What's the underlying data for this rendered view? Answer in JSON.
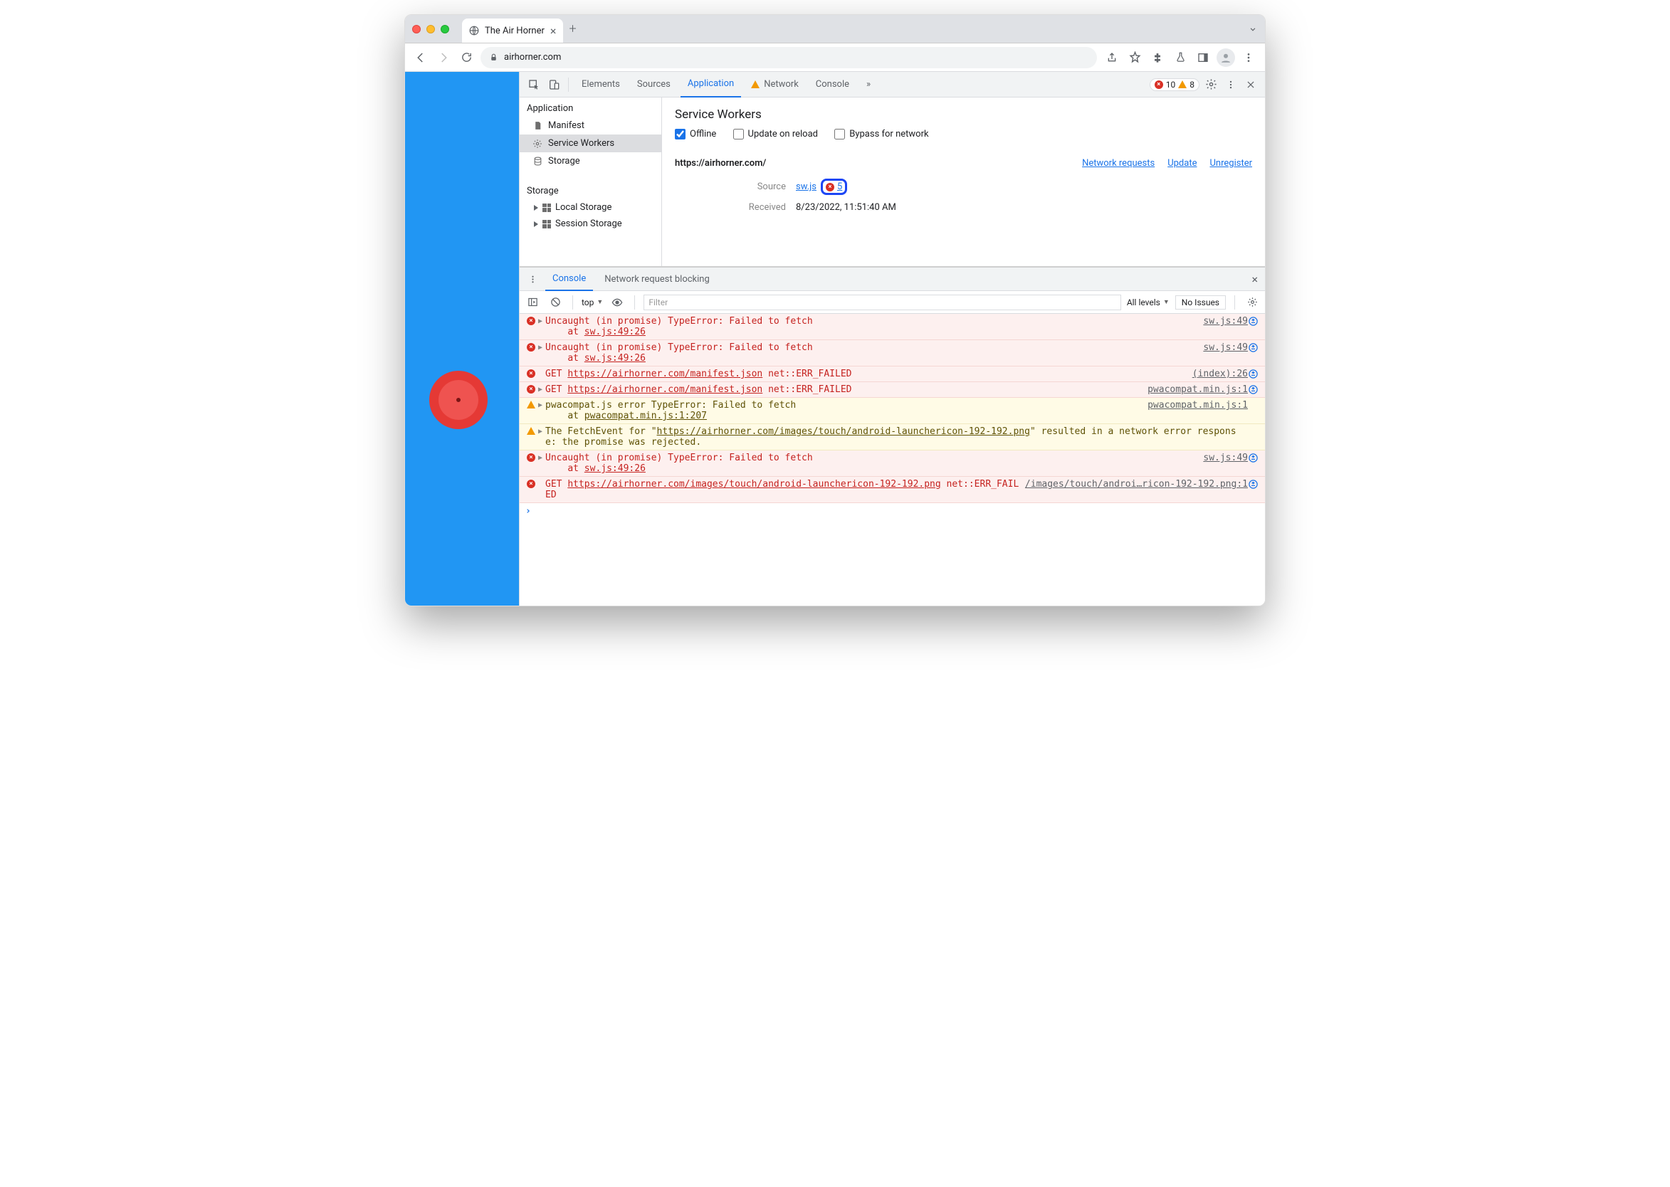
{
  "window": {
    "tab_title": "The Air Horner",
    "url_display": "airhorner.com"
  },
  "devtools": {
    "tabs": [
      "Elements",
      "Sources",
      "Application",
      "Network",
      "Console"
    ],
    "active_tab": "Application",
    "error_count": "10",
    "warn_count": "8"
  },
  "app_panel": {
    "section1_title": "Application",
    "items1": [
      "Manifest",
      "Service Workers",
      "Storage"
    ],
    "section2_title": "Storage",
    "items2": [
      "Local Storage",
      "Session Storage"
    ],
    "main_title": "Service Workers",
    "chk_offline": "Offline",
    "chk_update": "Update on reload",
    "chk_bypass": "Bypass for network",
    "origin": "https://airhorner.com/",
    "link_network": "Network requests",
    "link_update": "Update",
    "link_unregister": "Unregister",
    "label_source": "Source",
    "source_file": "sw.js",
    "source_err_count": "5",
    "label_received": "Received",
    "received_value": "8/23/2022, 11:51:40 AM"
  },
  "drawer": {
    "tabs": [
      "Console",
      "Network request blocking"
    ],
    "active": "Console",
    "context": "top",
    "filter_placeholder": "Filter",
    "levels": "All levels",
    "issues": "No Issues"
  },
  "console": [
    {
      "type": "err",
      "caret": true,
      "msg": "Uncaught (in promise) TypeError: Failed to fetch\n    at ",
      "msg_link": "sw.js:49:26",
      "src": "sw.js:49",
      "reload": true
    },
    {
      "type": "err",
      "caret": true,
      "msg": "Uncaught (in promise) TypeError: Failed to fetch\n    at ",
      "msg_link": "sw.js:49:26",
      "src": "sw.js:49",
      "reload": true
    },
    {
      "type": "err",
      "caret": false,
      "msg": "GET ",
      "msg_link": "https://airhorner.com/manifest.json",
      "msg_tail": " net::ERR_FAILED",
      "src": "(index):26",
      "reload": true
    },
    {
      "type": "err",
      "caret": true,
      "msg": "GET ",
      "msg_link": "https://airhorner.com/manifest.json",
      "msg_tail": " net::ERR_FAILED",
      "src": "pwacompat.min.js:1",
      "reload": true
    },
    {
      "type": "warn",
      "caret": true,
      "msg": "pwacompat.js error TypeError: Failed to fetch\n    at ",
      "msg_link": "pwacompat.min.js:1:207",
      "src": "pwacompat.min.js:1",
      "reload": false
    },
    {
      "type": "warn",
      "caret": true,
      "msg": "The FetchEvent for \"",
      "msg_link": "https://airhorner.com/images/touch/android-launchericon-192-192.png",
      "msg_tail": "\" resulted in a network error response: the promise was rejected.",
      "src": "",
      "reload": false
    },
    {
      "type": "err",
      "caret": true,
      "msg": "Uncaught (in promise) TypeError: Failed to fetch\n    at ",
      "msg_link": "sw.js:49:26",
      "src": "sw.js:49",
      "reload": true
    },
    {
      "type": "err",
      "caret": false,
      "msg": "GET ",
      "msg_link": "https://airhorner.com/images/touch/android-launchericon-192-192.png",
      "msg_tail": " net::ERR_FAILED",
      "src": "/images/touch/androi…ricon-192-192.png:1",
      "reload": true
    }
  ]
}
